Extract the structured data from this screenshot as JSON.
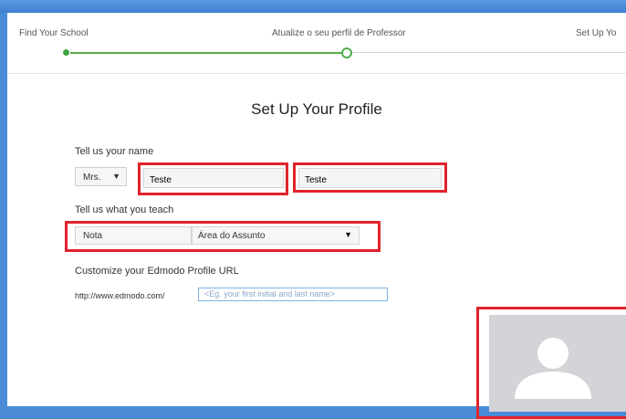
{
  "steps": {
    "step1": "Find Your School",
    "step2": "Atualize o seu perfil de Professor",
    "step3": "Set Up Yo"
  },
  "main": {
    "title": "Set Up Your Profile",
    "name_label": "Tell us your name",
    "title_select": "Mrs.",
    "first_name": "Teste",
    "last_name": "Teste",
    "teach_label": "Tell us what you teach",
    "grade_select": "Nota",
    "subject_select": "Área do Assunto",
    "url_label": "Customize your Edmodo Profile URL",
    "url_prefix": "http://www.edmodo.com/",
    "url_placeholder": "<Eg. your first initial and last name>"
  },
  "icons": {
    "caret": "▼",
    "avatar": "person-silhouette-icon"
  },
  "colors": {
    "accent_green": "#4caf50",
    "highlight_red": "#e0232c",
    "background_blue": "#4a8bd6"
  }
}
